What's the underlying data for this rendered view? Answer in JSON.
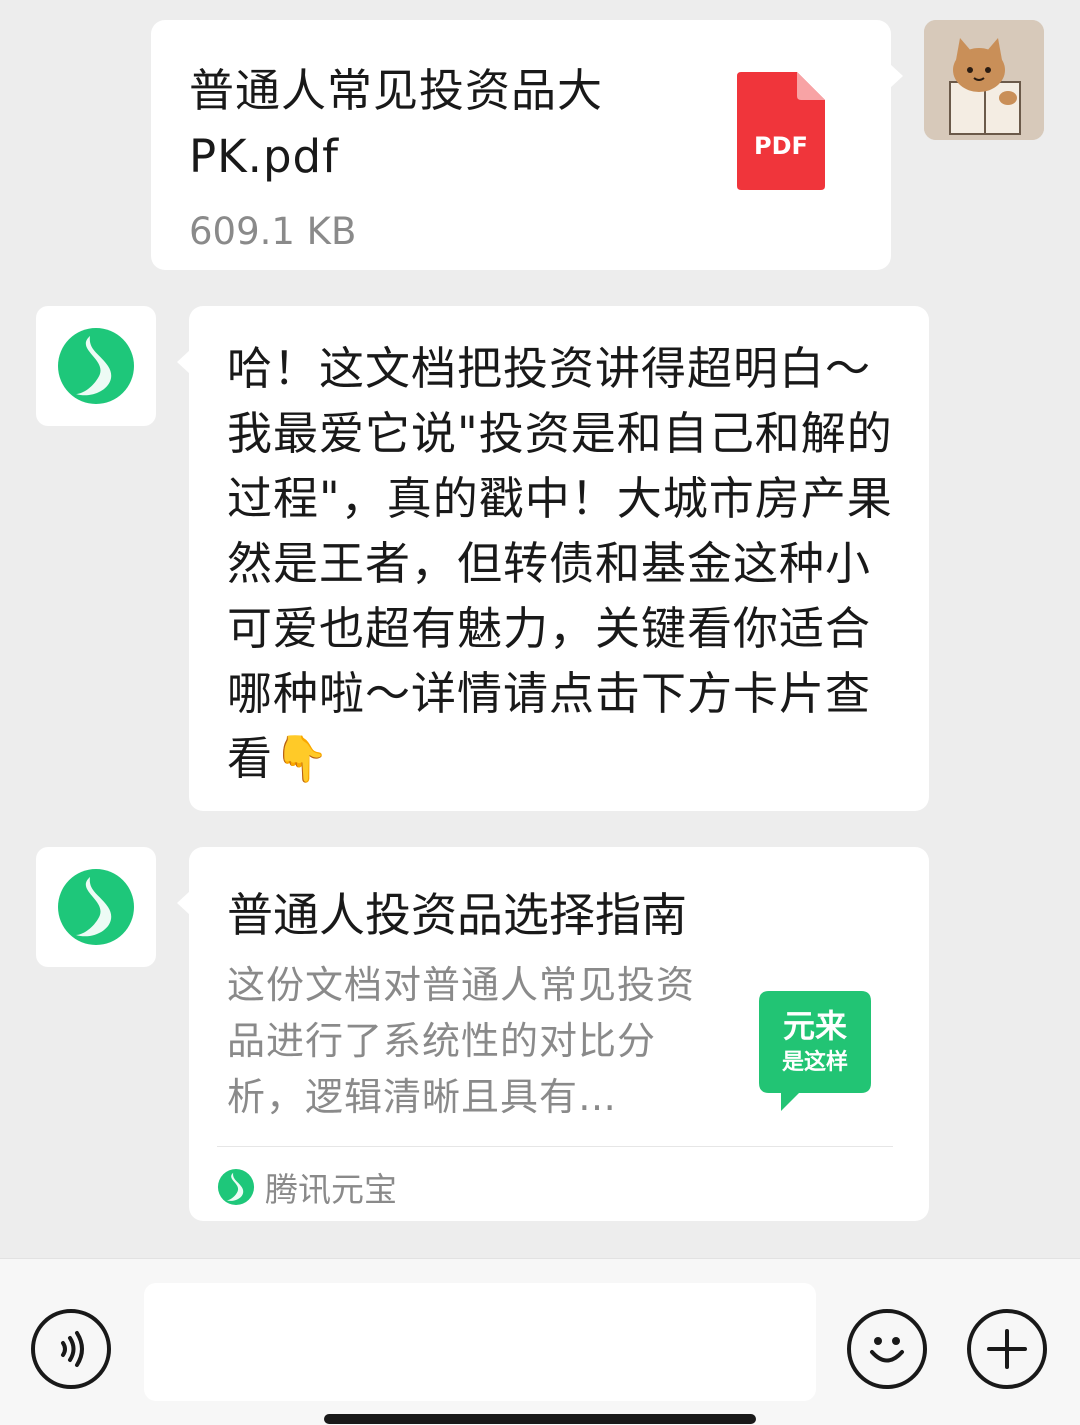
{
  "colors": {
    "background": "#ededed",
    "bubble": "#ffffff",
    "brand_green": "#1ec77a",
    "pdf_red": "#f0353b",
    "secondary_text": "#8a8a8a"
  },
  "messages": {
    "file": {
      "name": "普通人常见投资品大PK.pdf",
      "size": "609.1 KB",
      "icon_label": "PDF"
    },
    "text": {
      "content": "哈！这文档把投资讲得超明白～我最爱它说\"投资是和自己和解的过程\"，真的戳中！大城市房产果然是王者，但转债和基金这种小可爱也超有魅力，关键看你适合哪种啦～详情请点击下方卡片查看👇"
    },
    "card": {
      "title": "普通人投资品选择指南",
      "description": "这份文档对普通人常见投资品进行了系统性的对比分析，逻辑清晰且具有…",
      "thumb_line1": "元来",
      "thumb_line2": "是这样",
      "source": "腾讯元宝"
    }
  },
  "input_bar": {
    "value": "",
    "icons": [
      "voice-icon",
      "emoji-icon",
      "plus-icon"
    ]
  }
}
